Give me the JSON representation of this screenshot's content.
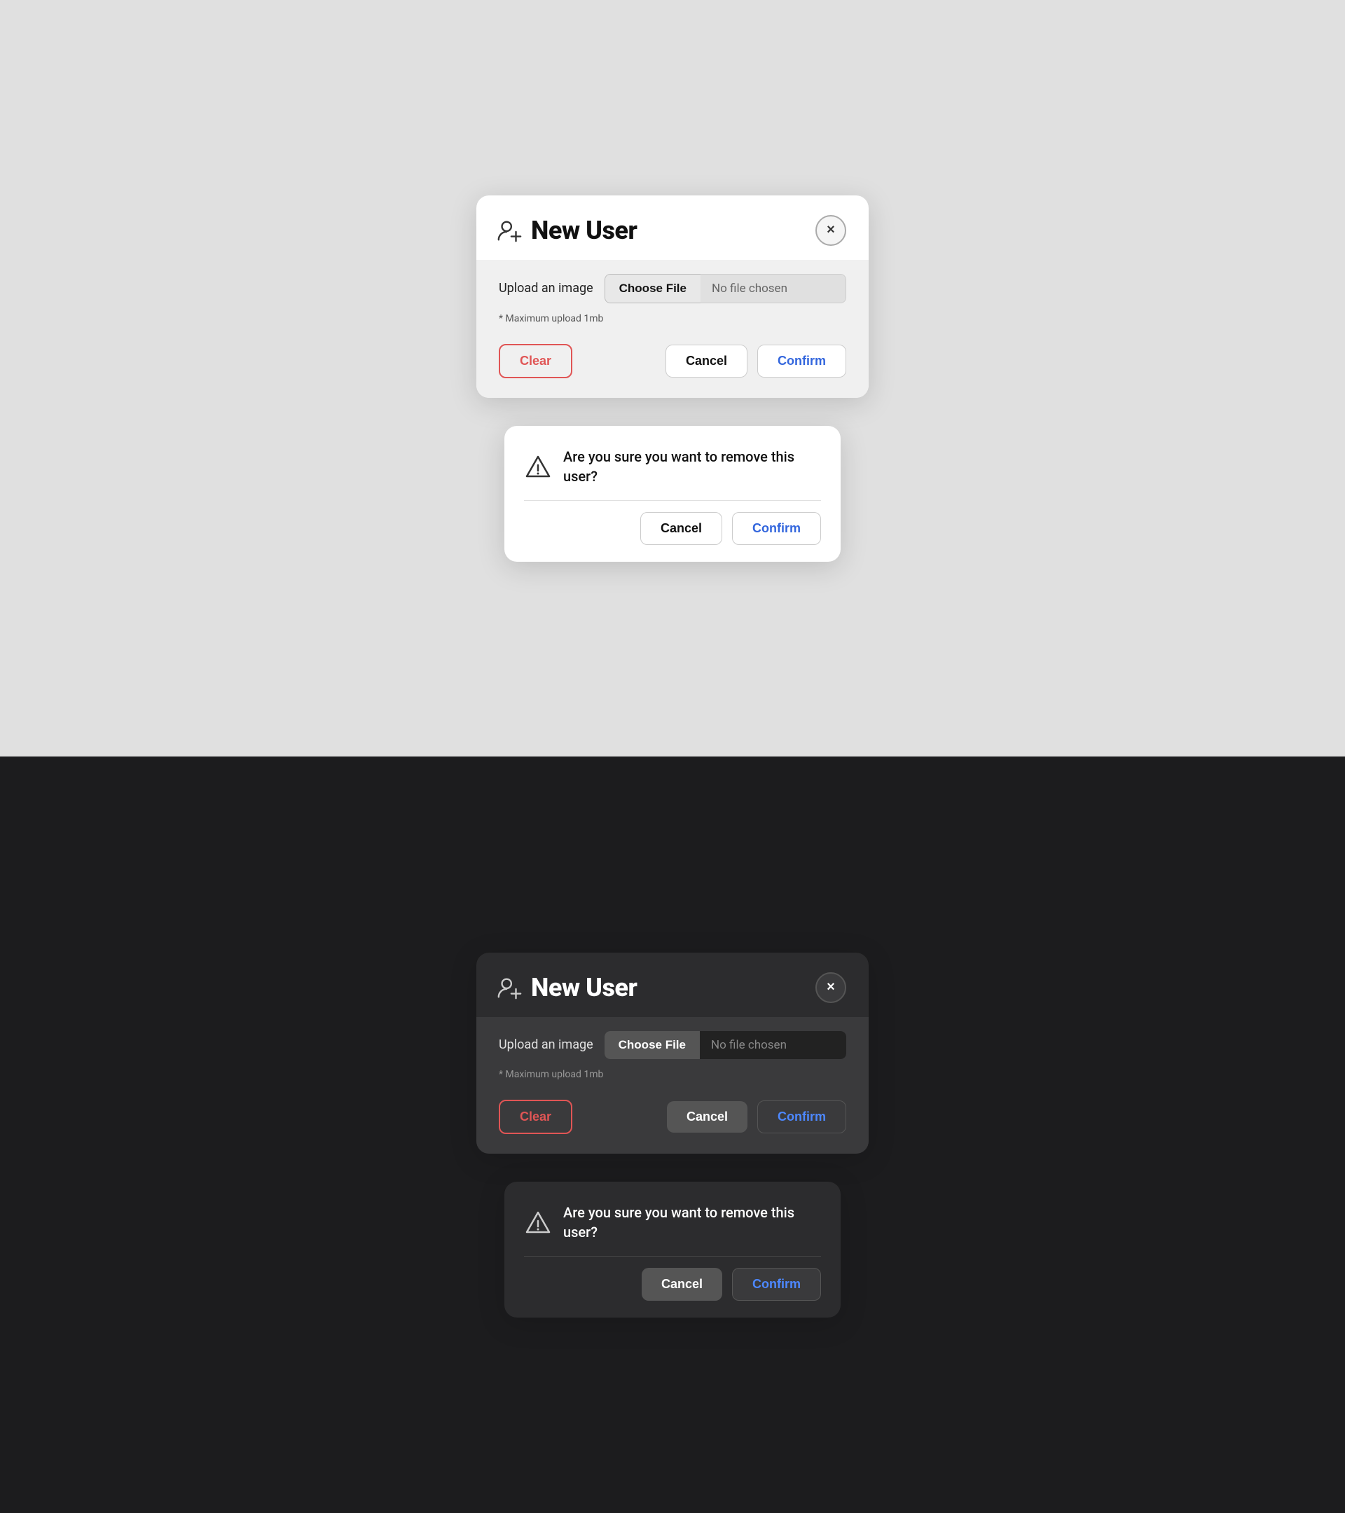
{
  "light": {
    "theme": "light",
    "modal": {
      "title": "New User",
      "close_label": "×",
      "upload_label": "Upload an image",
      "choose_file_label": "Choose File",
      "no_file_label": "No file chosen",
      "max_upload_note": "* Maximum upload 1mb",
      "clear_label": "Clear",
      "cancel_label": "Cancel",
      "confirm_label": "Confirm"
    },
    "confirm_dialog": {
      "message": "Are you sure you want to remove this user?",
      "cancel_label": "Cancel",
      "confirm_label": "Confirm"
    }
  },
  "dark": {
    "theme": "dark",
    "modal": {
      "title": "New User",
      "close_label": "×",
      "upload_label": "Upload an image",
      "choose_file_label": "Choose File",
      "no_file_label": "No file chosen",
      "max_upload_note": "* Maximum upload 1mb",
      "clear_label": "Clear",
      "cancel_label": "Cancel",
      "confirm_label": "Confirm"
    },
    "confirm_dialog": {
      "message": "Are you sure you want to remove this user?",
      "cancel_label": "Cancel",
      "confirm_label": "Confirm"
    }
  }
}
